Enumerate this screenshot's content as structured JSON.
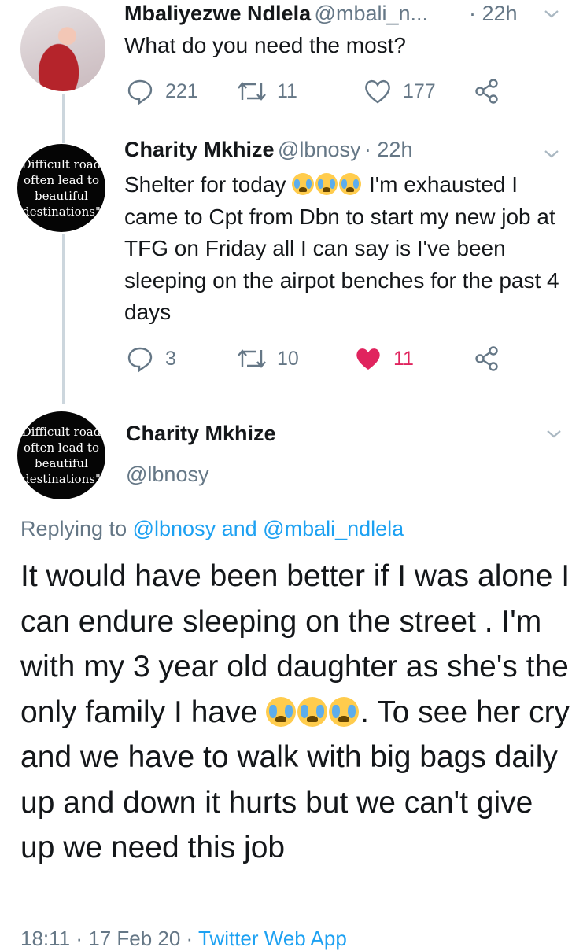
{
  "tweets": [
    {
      "name": "Mbaliyezwe Ndlela",
      "handle": "@mbali_n...",
      "time": "· 22h",
      "text": "What do you need the most?",
      "replies": "221",
      "retweets": "11",
      "likes": "177"
    },
    {
      "name": "Charity Mkhize",
      "handle": "@lbnosy",
      "time": "· 22h",
      "text_line1_a": "Shelter for today",
      "text_line1_b": "I'm exhausted",
      "text_rest": "I came to Cpt from Dbn to start my new job at TFG on Friday all I can say is I've been sleeping on the airpot benches for the past 4 days",
      "replies": "3",
      "retweets": "10",
      "likes": "11",
      "liked": true
    }
  ],
  "main": {
    "name": "Charity Mkhize",
    "handle": "@lbnosy",
    "replying_prefix": "Replying to",
    "replying_user1": "@lbnosy",
    "replying_and": "and",
    "replying_user2": "@mbali_ndlela",
    "text_a": "It would have been better if I was alone I can endure sleeping on the street . I'm with my 3 year old daughter as she's the only family I have",
    "text_b": ". To see her cry and we have to walk with big bags daily up and down it hurts but we can't give up we need this job",
    "timestamp": "18:11 · 17 Feb 20 ·",
    "source": "Twitter Web App"
  },
  "avatar_quote": {
    "line1": "Difficult road",
    "line2": "often lead to",
    "line3": "beautiful",
    "line4": "destinations\""
  },
  "icons": [
    "reply-icon",
    "retweet-icon",
    "heart-icon",
    "share-icon",
    "chevron-down-icon",
    "crying-face-emoji"
  ],
  "colors": {
    "link": "#1da1f2",
    "like": "#e0245e",
    "muted": "#657786"
  }
}
